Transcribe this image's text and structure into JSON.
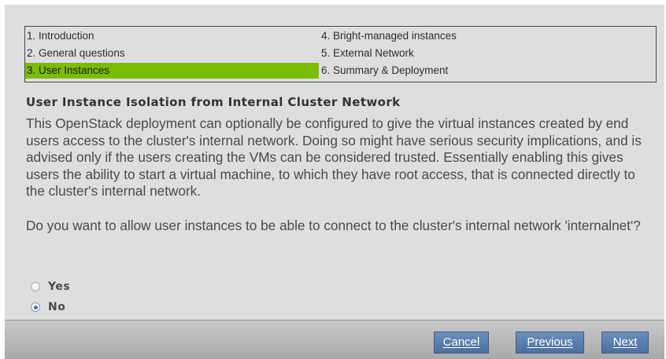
{
  "steps": [
    {
      "label": "1. Introduction"
    },
    {
      "label": "2. General questions"
    },
    {
      "label": "3. User Instances",
      "active": true
    },
    {
      "label": "4. Bright-managed instances"
    },
    {
      "label": "5. External Network"
    },
    {
      "label": "6. Summary & Deployment"
    }
  ],
  "section": {
    "title": "User Instance Isolation from Internal Cluster Network",
    "paragraph1": "This OpenStack deployment can optionally be configured to give the virtual instances created by end users access to the cluster's internal network. Doing so might have serious security implications, and is advised only if the users creating the VMs can be considered trusted. Essentially enabling this gives users the ability to start a virtual machine, to which they have root access, that is connected directly to the cluster's internal network.",
    "paragraph2": "Do you want to allow user instances to be able to connect to the cluster's internal network 'internalnet'?"
  },
  "options": {
    "yes_label": "Yes",
    "no_label": "No",
    "selected": "No"
  },
  "buttons": {
    "cancel": "Cancel",
    "previous": "Previous",
    "next": "Next"
  },
  "colors": {
    "active_step": "#7abd00",
    "button": "#5a7eae",
    "background": "#dedede"
  }
}
